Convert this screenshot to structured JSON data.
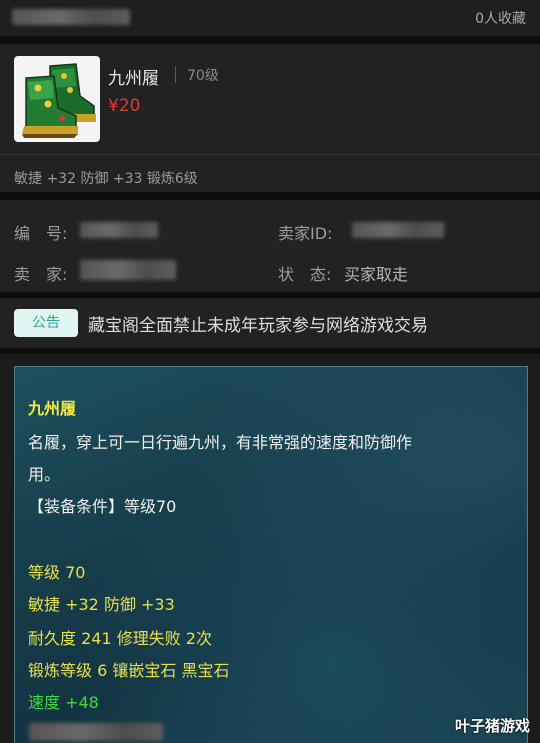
{
  "header": {
    "collect_count": "0人收藏"
  },
  "item": {
    "name": "九州履",
    "level": "70级",
    "price": "¥20",
    "stats": "敏捷 +32 防御 +33 锻炼6级"
  },
  "info": {
    "number_label": "编　号:",
    "seller_id_label": "卖家ID:",
    "seller_label": "卖　家:",
    "status_label": "状　态:",
    "status_value": "买家取走"
  },
  "notice": {
    "tag": "公告",
    "text": "藏宝阁全面禁止未成年玩家参与网络游戏交易"
  },
  "tooltip": {
    "title": "九州履",
    "desc_line1": "名履，穿上可一日行遍九州，有非常强的速度和防御作",
    "desc_line2": "用。",
    "requirement": "【装备条件】等级70",
    "level": "等级 70",
    "attr": "敏捷 +32 防御 +33",
    "durability": "耐久度 241 修理失败 2次",
    "forge": "锻炼等级 6 镶嵌宝石 黑宝石",
    "speed": "速度 +48"
  },
  "watermark": "叶子猪游戏",
  "colors": {
    "price": "#e0392f",
    "tip_title": "#f2ea3c",
    "tip_yellow": "#e8e04a",
    "tip_green": "#3ddc3d",
    "notice_tag_bg": "#e1f5f3",
    "notice_tag_fg": "#2aa79a"
  },
  "icons": {
    "item_thumbnail": "boots-icon"
  }
}
